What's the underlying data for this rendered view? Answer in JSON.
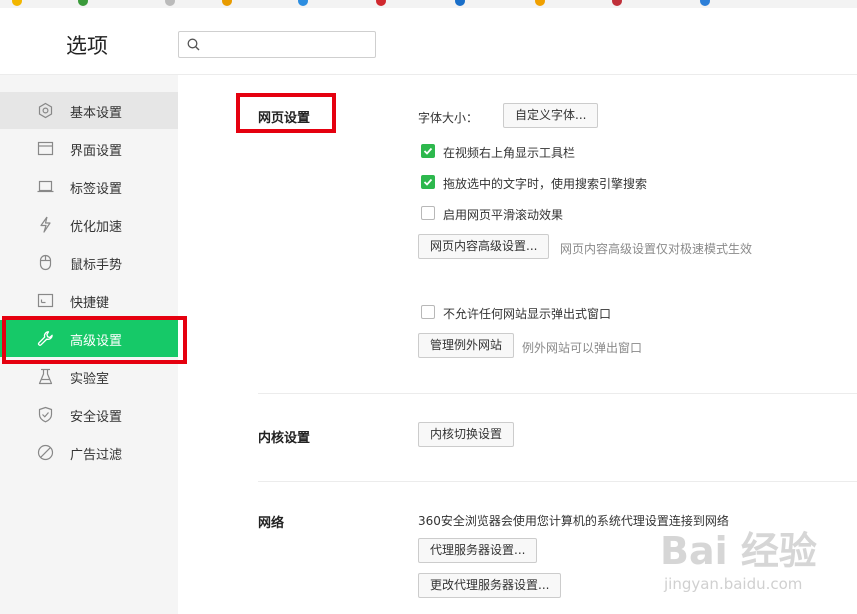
{
  "header": {
    "title": "选项",
    "search_placeholder": ""
  },
  "sidebar": {
    "items": [
      {
        "label": "基本设置",
        "icon": "gear-icon"
      },
      {
        "label": "界面设置",
        "icon": "window-icon"
      },
      {
        "label": "标签设置",
        "icon": "tab-icon"
      },
      {
        "label": "优化加速",
        "icon": "lightning-icon"
      },
      {
        "label": "鼠标手势",
        "icon": "mouse-icon"
      },
      {
        "label": "快捷键",
        "icon": "keyboard-icon"
      },
      {
        "label": "高级设置",
        "icon": "wrench-icon"
      },
      {
        "label": "实验室",
        "icon": "flask-icon"
      },
      {
        "label": "安全设置",
        "icon": "shield-icon"
      },
      {
        "label": "广告过滤",
        "icon": "block-icon"
      }
    ],
    "active_index": 6,
    "hover_index": 0
  },
  "webpage": {
    "title": "网页设置",
    "font_size_label": "字体大小：",
    "custom_font_button": "自定义字体...",
    "show_toolbar": {
      "label": "在视频右上角显示工具栏",
      "checked": true
    },
    "drag_search": {
      "label": "拖放选中的文字时，使用搜索引擎搜索",
      "checked": true
    },
    "smooth_scroll": {
      "label": "启用网页平滑滚动效果",
      "checked": false
    },
    "advanced_button": "网页内容高级设置...",
    "advanced_hint": "网页内容高级设置仅对极速模式生效",
    "block_popups": {
      "label": "不允许任何网站显示弹出式窗口",
      "checked": false
    },
    "exceptions_button": "管理例外网站",
    "exceptions_hint": "例外网站可以弹出窗口"
  },
  "kernel": {
    "title": "内核设置",
    "switch_button": "内核切换设置"
  },
  "network": {
    "title": "网络",
    "description": "360安全浏览器会使用您计算机的系统代理设置连接到网络",
    "proxy_button": "代理服务器设置...",
    "change_proxy_button": "更改代理服务器设置..."
  },
  "watermark": {
    "logo": "Bai 经验",
    "sub": "jingyan.baidu.com"
  },
  "colors": {
    "accent": "#16c968",
    "highlight": "#e5000f",
    "checkbox": "#2db84d"
  }
}
